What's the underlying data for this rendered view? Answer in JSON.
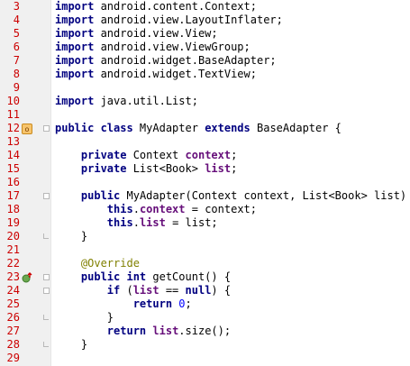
{
  "editor": {
    "lines": [
      {
        "n": "3",
        "segments": [
          [
            "kw",
            "import"
          ],
          [
            "t",
            " android.content.Context;"
          ]
        ]
      },
      {
        "n": "4",
        "segments": [
          [
            "kw",
            "import"
          ],
          [
            "t",
            " android.view.LayoutInflater;"
          ]
        ]
      },
      {
        "n": "5",
        "segments": [
          [
            "kw",
            "import"
          ],
          [
            "t",
            " android.view.View;"
          ]
        ]
      },
      {
        "n": "6",
        "segments": [
          [
            "kw",
            "import"
          ],
          [
            "t",
            " android.view.ViewGroup;"
          ]
        ]
      },
      {
        "n": "7",
        "segments": [
          [
            "kw",
            "import"
          ],
          [
            "t",
            " android.widget.BaseAdapter;"
          ]
        ]
      },
      {
        "n": "8",
        "segments": [
          [
            "kw",
            "import"
          ],
          [
            "t",
            " android.widget.TextView;"
          ]
        ]
      },
      {
        "n": "9",
        "segments": []
      },
      {
        "n": "10",
        "segments": [
          [
            "kw",
            "import"
          ],
          [
            "t",
            " java.util.List;"
          ]
        ]
      },
      {
        "n": "11",
        "segments": []
      },
      {
        "n": "12",
        "segments": [
          [
            "kw",
            "public class"
          ],
          [
            "t",
            " MyAdapter "
          ],
          [
            "kw",
            "extends"
          ],
          [
            "t",
            " BaseAdapter {"
          ]
        ]
      },
      {
        "n": "13",
        "segments": []
      },
      {
        "n": "14",
        "segments": [
          [
            "t",
            "    "
          ],
          [
            "kw",
            "private"
          ],
          [
            "t",
            " Context "
          ],
          [
            "field",
            "context"
          ],
          [
            "t",
            ";"
          ]
        ]
      },
      {
        "n": "15",
        "segments": [
          [
            "t",
            "    "
          ],
          [
            "kw",
            "private"
          ],
          [
            "t",
            " List<Book> "
          ],
          [
            "field",
            "list"
          ],
          [
            "t",
            ";"
          ]
        ]
      },
      {
        "n": "16",
        "segments": []
      },
      {
        "n": "17",
        "segments": [
          [
            "t",
            "    "
          ],
          [
            "kw",
            "public"
          ],
          [
            "t",
            " MyAdapter(Context context, List<Book> list) {"
          ]
        ]
      },
      {
        "n": "18",
        "segments": [
          [
            "t",
            "        "
          ],
          [
            "kw",
            "this"
          ],
          [
            "t",
            "."
          ],
          [
            "field",
            "context"
          ],
          [
            "t",
            " = context;"
          ]
        ]
      },
      {
        "n": "19",
        "segments": [
          [
            "t",
            "        "
          ],
          [
            "kw",
            "this"
          ],
          [
            "t",
            "."
          ],
          [
            "field",
            "list"
          ],
          [
            "t",
            " = list;"
          ]
        ]
      },
      {
        "n": "20",
        "segments": [
          [
            "t",
            "    }"
          ]
        ]
      },
      {
        "n": "21",
        "segments": []
      },
      {
        "n": "22",
        "segments": [
          [
            "t",
            "    "
          ],
          [
            "ann",
            "@Override"
          ]
        ]
      },
      {
        "n": "23",
        "segments": [
          [
            "t",
            "    "
          ],
          [
            "kw",
            "public int"
          ],
          [
            "t",
            " getCount() {"
          ]
        ]
      },
      {
        "n": "24",
        "segments": [
          [
            "t",
            "        "
          ],
          [
            "kw",
            "if"
          ],
          [
            "t",
            " ("
          ],
          [
            "field",
            "list"
          ],
          [
            "t",
            " == "
          ],
          [
            "kw",
            "null"
          ],
          [
            "t",
            ") {"
          ]
        ]
      },
      {
        "n": "25",
        "segments": [
          [
            "t",
            "            "
          ],
          [
            "kw",
            "return"
          ],
          [
            "t",
            " "
          ],
          [
            "num",
            "0"
          ],
          [
            "t",
            ";"
          ]
        ]
      },
      {
        "n": "26",
        "segments": [
          [
            "t",
            "        }"
          ]
        ]
      },
      {
        "n": "27",
        "segments": [
          [
            "t",
            "        "
          ],
          [
            "kw",
            "return"
          ],
          [
            "t",
            " "
          ],
          [
            "field",
            "list"
          ],
          [
            "t",
            ".size();"
          ]
        ]
      },
      {
        "n": "28",
        "segments": [
          [
            "t",
            "    }"
          ]
        ]
      },
      {
        "n": "29",
        "segments": []
      }
    ],
    "gutter_icons": [
      {
        "line": "12",
        "icon": "implemented-class-icon"
      },
      {
        "line": "23",
        "icon": "override-method-icon"
      }
    ],
    "colors": {
      "keyword": "#000080",
      "field": "#660e7a",
      "number": "#0000ff",
      "annotation": "#808000",
      "line_number": "#cc0000",
      "gutter_bg": "#f0f0f0"
    }
  }
}
